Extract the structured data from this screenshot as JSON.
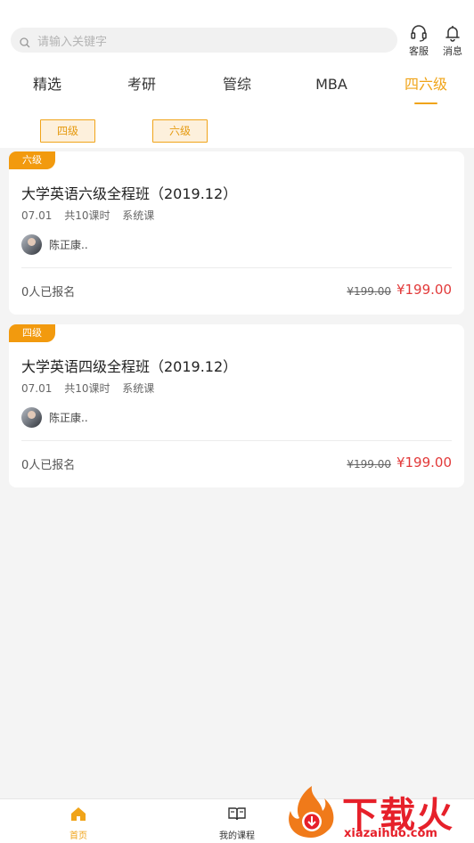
{
  "search": {
    "placeholder": "请输入关键字"
  },
  "top_actions": {
    "service_label": "客服",
    "message_label": "消息"
  },
  "tabs": [
    {
      "label": "精选"
    },
    {
      "label": "考研"
    },
    {
      "label": "管综"
    },
    {
      "label": "MBA"
    },
    {
      "label": "四六级",
      "active": true
    }
  ],
  "sub_tags": [
    {
      "label": "四级"
    },
    {
      "label": "六级"
    }
  ],
  "courses": [
    {
      "badge": "六级",
      "title": "大学英语六级全程班（2019.12）",
      "date": "07.01",
      "lessons": "共10课时",
      "type": "系统课",
      "teacher": "陈正康..",
      "enrolled": "0人已报名",
      "old_price": "¥199.00",
      "price": "¥199.00"
    },
    {
      "badge": "四级",
      "title": "大学英语四级全程班（2019.12）",
      "date": "07.01",
      "lessons": "共10课时",
      "type": "系统课",
      "teacher": "陈正康..",
      "enrolled": "0人已报名",
      "old_price": "¥199.00",
      "price": "¥199.00"
    }
  ],
  "bottom_nav": {
    "home_label": "首页",
    "courses_label": "我的课程"
  },
  "watermark": {
    "brand": "下载火",
    "url": "xiazaihuo.com"
  },
  "colors": {
    "accent": "#f0a419",
    "price": "#e23a3a",
    "badge": "#f29a0e"
  }
}
